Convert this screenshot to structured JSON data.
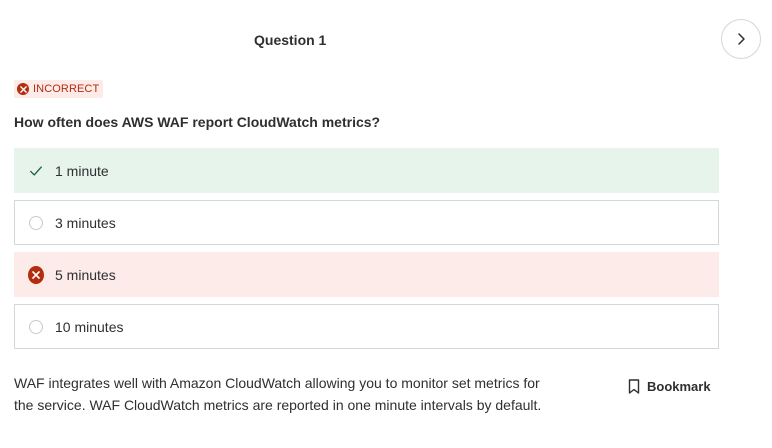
{
  "header": {
    "question_title": "Question 1",
    "next_icon": "chevron-right-icon"
  },
  "status": {
    "label": "INCORRECT",
    "icon": "x-circle-icon",
    "color": "#b32d0f"
  },
  "question": {
    "text": "How often does AWS WAF report CloudWatch metrics?"
  },
  "options": [
    {
      "label": "1 minute",
      "state": "correct",
      "icon": "check-icon"
    },
    {
      "label": "3 minutes",
      "state": "unselected",
      "icon": "radio-icon"
    },
    {
      "label": "5 minutes",
      "state": "incorrect-selected",
      "icon": "x-circle-icon"
    },
    {
      "label": "10 minutes",
      "state": "unselected",
      "icon": "radio-icon"
    }
  ],
  "explanation": {
    "text": "WAF integrates well with Amazon CloudWatch allowing you to monitor set metrics for the service. WAF CloudWatch metrics are reported in one minute intervals by default."
  },
  "bookmark": {
    "label": "Bookmark",
    "icon": "bookmark-icon"
  },
  "colors": {
    "correct_bg": "#e6f4ec",
    "incorrect_bg": "#fcebe9",
    "correct_check": "#1e6055",
    "border": "#d1d7dc"
  }
}
